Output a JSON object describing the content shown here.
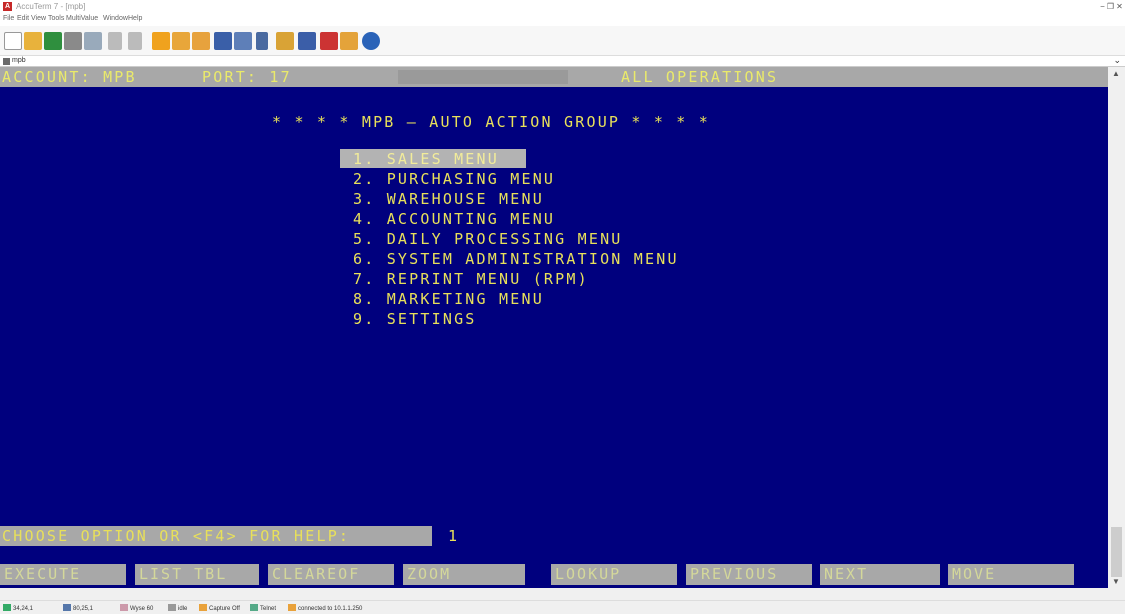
{
  "window": {
    "title": "AccuTerm 7 - [mpb]",
    "app_icon": "A",
    "controls": [
      "−",
      "❐",
      "✕"
    ]
  },
  "menubar": [
    "File",
    "Edit",
    "View",
    "Tools",
    "MultiValue",
    "Window",
    "Help"
  ],
  "toolbar_icons": [
    "new-document-icon",
    "open-folder-icon",
    "save-icon",
    "print-icon",
    "grid-icon",
    "copy-icon",
    "paste-icon",
    "folder-star-icon",
    "folder-open-icon",
    "folder-arrow-icon",
    "list-icon",
    "table-icon",
    "chart-icon",
    "gear-icon",
    "filter-icon",
    "monitor-icon",
    "flag-icon",
    "help-icon"
  ],
  "document_tab": {
    "label": "mpb",
    "chevron": "⌄"
  },
  "terminal": {
    "status": {
      "account": "ACCOUNT: MPB",
      "port": "PORT: 17",
      "operations": "ALL OPERATIONS"
    },
    "heading": "* * * * MPB — AUTO ACTION GROUP * * * *",
    "menu": [
      "1. SALES MENU",
      "2. PURCHASING MENU",
      "3. WAREHOUSE MENU",
      "4. ACCOUNTING MENU",
      "5. DAILY PROCESSING MENU",
      "6. SYSTEM ADMINISTRATION MENU",
      "7. REPRINT MENU (RPM)",
      "8. MARKETING MENU",
      "9. SETTINGS"
    ],
    "selected_index": 0,
    "prompt": {
      "label": "CHOOSE OPTION OR <F4> FOR HELP:",
      "value": "1"
    },
    "function_keys": [
      "EXECUTE",
      "LIST TBL",
      "CLEAREOF",
      "ZOOM",
      "LOOKUP",
      "PREVIOUS",
      "NEXT",
      "MOVE"
    ]
  },
  "statusbar": {
    "cursor": "34,24,1",
    "size": "80,25,1",
    "emulation": "Wyse 60",
    "state": "idle",
    "capture": "Capture Off",
    "protocol": "Telnet",
    "connection": "connected to 10.1.1.250"
  },
  "colors": {
    "terminal_bg": "#00007e",
    "terminal_fg": "#e8e05a",
    "bar_gray": "#a8a8a8"
  }
}
